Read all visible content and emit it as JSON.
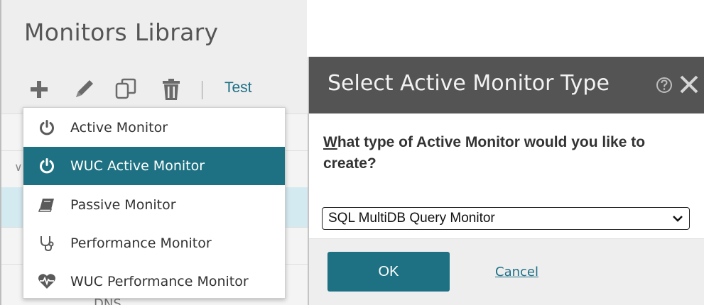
{
  "library": {
    "title": "Monitors Library",
    "toolbar": {
      "add_icon": "plus-icon",
      "edit_icon": "pencil-icon",
      "copy_icon": "copy-icon",
      "delete_icon": "trash-icon",
      "test_label": "Test"
    },
    "list": {
      "partial_row_label": "DNS"
    }
  },
  "dropdown": {
    "items": [
      {
        "label": "Active Monitor",
        "icon": "power-icon",
        "selected": false
      },
      {
        "label": "WUC Active Monitor",
        "icon": "power-icon",
        "selected": true
      },
      {
        "label": "Passive Monitor",
        "icon": "book-icon",
        "selected": false
      },
      {
        "label": "Performance Monitor",
        "icon": "stethoscope-icon",
        "selected": false
      },
      {
        "label": "WUC Performance Monitor",
        "icon": "heart-pulse-icon",
        "selected": false
      }
    ]
  },
  "dialog": {
    "title": "Select Active Monitor Type",
    "help_icon": "help-circle-icon",
    "close_icon": "close-icon",
    "question_first": "W",
    "question_rest": "hat type of Active Monitor would you like to create?",
    "select_value": "SQL MultiDB Query Monitor",
    "ok_label": "OK",
    "cancel_label": "Cancel"
  },
  "colors": {
    "accent": "#1e7182",
    "header": "#545454",
    "link": "#1d6f86",
    "panel": "#eeeeee"
  }
}
